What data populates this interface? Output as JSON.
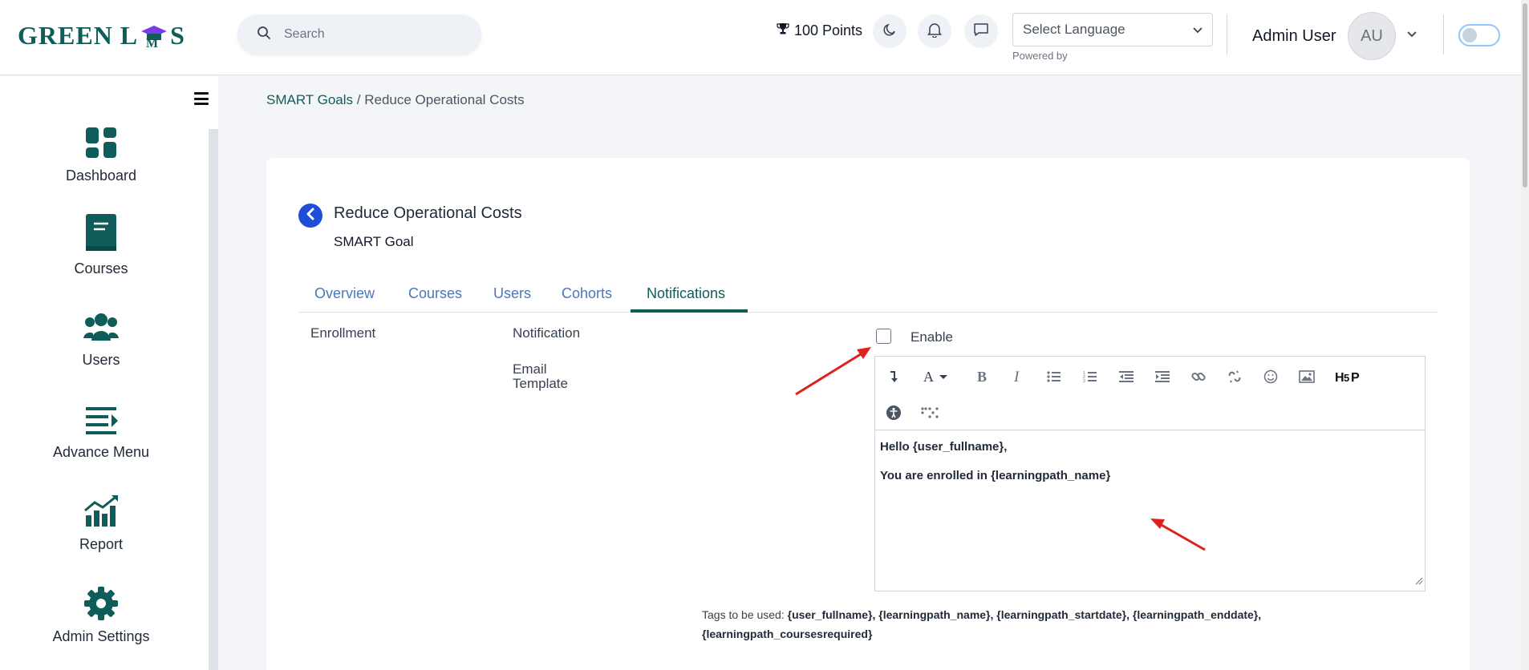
{
  "header": {
    "logo_text_left": "GREEN L",
    "logo_text_right": "S",
    "search_placeholder": "Search",
    "points": "100 Points",
    "language_select": "Select Language",
    "powered_by": "Powered by",
    "user_name": "Admin User",
    "avatar_initials": "AU"
  },
  "sidebar": {
    "items": [
      {
        "label": "Dashboard"
      },
      {
        "label": "Courses"
      },
      {
        "label": "Users"
      },
      {
        "label": "Advance Menu"
      },
      {
        "label": "Report"
      },
      {
        "label": "Admin Settings"
      }
    ]
  },
  "breadcrumb": {
    "root": "SMART Goals",
    "separator": "/",
    "current": "Reduce Operational Costs"
  },
  "page": {
    "title": "Reduce Operational Costs",
    "subtitle": "SMART Goal"
  },
  "tabs": [
    {
      "label": "Overview"
    },
    {
      "label": "Courses"
    },
    {
      "label": "Users"
    },
    {
      "label": "Cohorts"
    },
    {
      "label": "Notifications",
      "active": true
    }
  ],
  "form": {
    "section_label": "Enrollment",
    "notification_label": "Notification",
    "email_template_label": "Email Template",
    "enable_label": "Enable",
    "enable_checked": false,
    "editor_lines": [
      "Hello {user_fullname},",
      "You are enrolled in  {learningpath_name}"
    ],
    "tags_prefix": "Tags to be used:",
    "tags_list": "{user_fullname}, {learningpath_name}, {learningpath_startdate}, {learningpath_enddate}, {learningpath_coursesrequired}"
  },
  "colors": {
    "brand": "#0f5d5a",
    "tab_link": "#4a78b8",
    "back_button": "#1d4ed8",
    "annotation_arrow": "#e0201b"
  }
}
